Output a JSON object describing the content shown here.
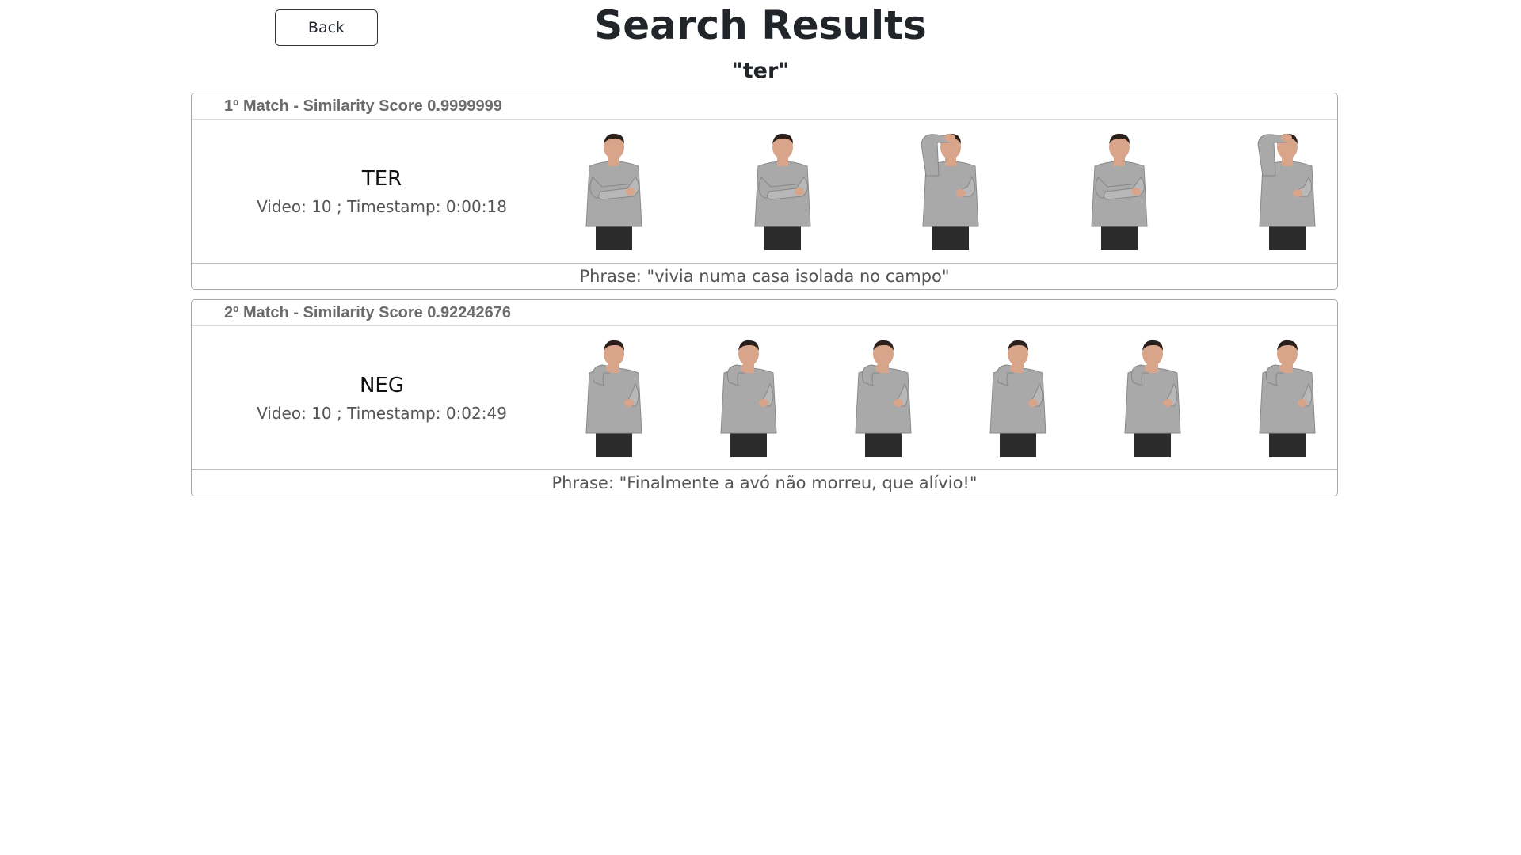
{
  "header": {
    "back_label": "Back",
    "title": "Search Results",
    "query": "\"ter\""
  },
  "results": [
    {
      "header": "1º Match - Similarity Score 0.9999999",
      "gloss": "TER",
      "meta": "Video: 10 ; Timestamp: 0:00:18",
      "phrase": "Phrase: \"vivia numa casa isolada no campo\"",
      "frames": [
        "arms-crossed",
        "arms-crossed",
        "arm-raised",
        "arms-crossed",
        "arm-raised"
      ]
    },
    {
      "header": "2º Match - Similarity Score 0.92242676",
      "gloss": "NEG",
      "meta": "Video: 10 ; Timestamp: 0:02:49",
      "phrase": "Phrase: \"Finalmente a avó não morreu, que alívio!\"",
      "frames": [
        "hand-to-face",
        "hand-to-face",
        "hand-to-face",
        "hand-to-face",
        "hand-to-face",
        "hand-to-face"
      ]
    }
  ],
  "colors": {
    "shirt": "#a9a9a9",
    "skin": "#d8a48a",
    "hair": "#2a1f1a",
    "pants": "#2b2b2b"
  }
}
